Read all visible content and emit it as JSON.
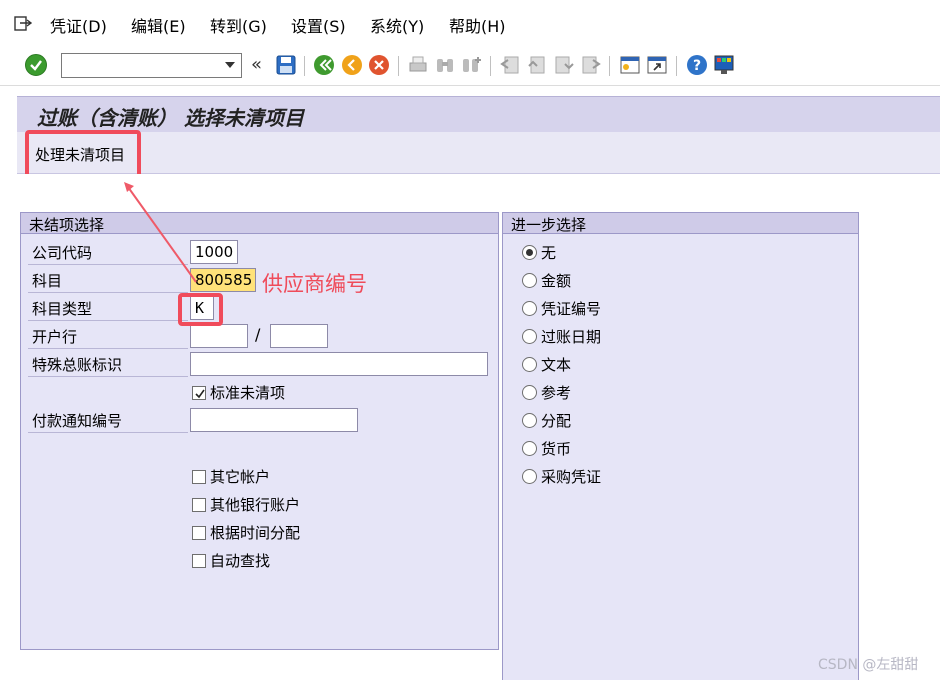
{
  "menu": {
    "icon": "exit-menu-icon",
    "items": [
      "凭证(D)",
      "编辑(E)",
      "转到(G)",
      "设置(S)",
      "系统(Y)",
      "帮助(H)"
    ]
  },
  "toolbar": {
    "command_value": "",
    "back_glyph": "«",
    "icons": [
      "save-icon",
      "back-icon",
      "exit-icon",
      "cancel-icon",
      "print-icon",
      "find-icon",
      "find-next-icon",
      "first-page-icon",
      "previous-page-icon",
      "next-page-icon",
      "last-page-icon",
      "create-session-icon",
      "shortcut-icon",
      "help-icon",
      "layout-icon"
    ]
  },
  "title": "过账（含清账） 选择未清项目",
  "app_toolbar": {
    "process_open_items": "处理未清项目"
  },
  "open_item_selection": {
    "title": "未结项选择",
    "company_code": {
      "label": "公司代码",
      "value": "1000"
    },
    "account": {
      "label": "科目",
      "value": "800585"
    },
    "account_type": {
      "label": "科目类型",
      "value": "K"
    },
    "bank": {
      "label": "开户行",
      "separator": "/"
    },
    "special_gl_indicator": {
      "label": "特殊总账标识"
    },
    "standard_open_items": {
      "label": "标准未清项",
      "checked": true
    },
    "payment_advice_no": {
      "label": "付款通知编号"
    },
    "other_accounts": {
      "label": "其它帐户",
      "checked": false
    },
    "other_bank_accounts": {
      "label": "其他银行账户",
      "checked": false
    },
    "distribute_by_age": {
      "label": "根据时间分配",
      "checked": false
    },
    "automatic_search": {
      "label": "自动查找",
      "checked": false
    }
  },
  "additional_selections": {
    "title": "进一步选择",
    "options": [
      "无",
      "金额",
      "凭证编号",
      "过账日期",
      "文本",
      "参考",
      "分配",
      "货币",
      "采购凭证"
    ],
    "selected_index": 0
  },
  "annotation": {
    "text": "供应商编号",
    "color": "#ef4b5a"
  },
  "watermark": "CSDN @左甜甜"
}
